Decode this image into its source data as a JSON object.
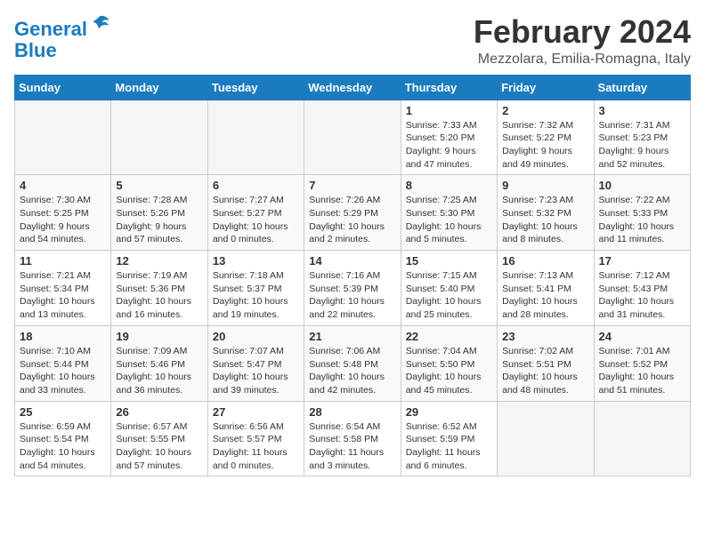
{
  "logo": {
    "line1": "General",
    "line2": "Blue"
  },
  "title": "February 2024",
  "subtitle": "Mezzolara, Emilia-Romagna, Italy",
  "days_header": [
    "Sunday",
    "Monday",
    "Tuesday",
    "Wednesday",
    "Thursday",
    "Friday",
    "Saturday"
  ],
  "weeks": [
    [
      {
        "day": "",
        "info": ""
      },
      {
        "day": "",
        "info": ""
      },
      {
        "day": "",
        "info": ""
      },
      {
        "day": "",
        "info": ""
      },
      {
        "day": "1",
        "info": "Sunrise: 7:33 AM\nSunset: 5:20 PM\nDaylight: 9 hours and 47 minutes."
      },
      {
        "day": "2",
        "info": "Sunrise: 7:32 AM\nSunset: 5:22 PM\nDaylight: 9 hours and 49 minutes."
      },
      {
        "day": "3",
        "info": "Sunrise: 7:31 AM\nSunset: 5:23 PM\nDaylight: 9 hours and 52 minutes."
      }
    ],
    [
      {
        "day": "4",
        "info": "Sunrise: 7:30 AM\nSunset: 5:25 PM\nDaylight: 9 hours and 54 minutes."
      },
      {
        "day": "5",
        "info": "Sunrise: 7:28 AM\nSunset: 5:26 PM\nDaylight: 9 hours and 57 minutes."
      },
      {
        "day": "6",
        "info": "Sunrise: 7:27 AM\nSunset: 5:27 PM\nDaylight: 10 hours and 0 minutes."
      },
      {
        "day": "7",
        "info": "Sunrise: 7:26 AM\nSunset: 5:29 PM\nDaylight: 10 hours and 2 minutes."
      },
      {
        "day": "8",
        "info": "Sunrise: 7:25 AM\nSunset: 5:30 PM\nDaylight: 10 hours and 5 minutes."
      },
      {
        "day": "9",
        "info": "Sunrise: 7:23 AM\nSunset: 5:32 PM\nDaylight: 10 hours and 8 minutes."
      },
      {
        "day": "10",
        "info": "Sunrise: 7:22 AM\nSunset: 5:33 PM\nDaylight: 10 hours and 11 minutes."
      }
    ],
    [
      {
        "day": "11",
        "info": "Sunrise: 7:21 AM\nSunset: 5:34 PM\nDaylight: 10 hours and 13 minutes."
      },
      {
        "day": "12",
        "info": "Sunrise: 7:19 AM\nSunset: 5:36 PM\nDaylight: 10 hours and 16 minutes."
      },
      {
        "day": "13",
        "info": "Sunrise: 7:18 AM\nSunset: 5:37 PM\nDaylight: 10 hours and 19 minutes."
      },
      {
        "day": "14",
        "info": "Sunrise: 7:16 AM\nSunset: 5:39 PM\nDaylight: 10 hours and 22 minutes."
      },
      {
        "day": "15",
        "info": "Sunrise: 7:15 AM\nSunset: 5:40 PM\nDaylight: 10 hours and 25 minutes."
      },
      {
        "day": "16",
        "info": "Sunrise: 7:13 AM\nSunset: 5:41 PM\nDaylight: 10 hours and 28 minutes."
      },
      {
        "day": "17",
        "info": "Sunrise: 7:12 AM\nSunset: 5:43 PM\nDaylight: 10 hours and 31 minutes."
      }
    ],
    [
      {
        "day": "18",
        "info": "Sunrise: 7:10 AM\nSunset: 5:44 PM\nDaylight: 10 hours and 33 minutes."
      },
      {
        "day": "19",
        "info": "Sunrise: 7:09 AM\nSunset: 5:46 PM\nDaylight: 10 hours and 36 minutes."
      },
      {
        "day": "20",
        "info": "Sunrise: 7:07 AM\nSunset: 5:47 PM\nDaylight: 10 hours and 39 minutes."
      },
      {
        "day": "21",
        "info": "Sunrise: 7:06 AM\nSunset: 5:48 PM\nDaylight: 10 hours and 42 minutes."
      },
      {
        "day": "22",
        "info": "Sunrise: 7:04 AM\nSunset: 5:50 PM\nDaylight: 10 hours and 45 minutes."
      },
      {
        "day": "23",
        "info": "Sunrise: 7:02 AM\nSunset: 5:51 PM\nDaylight: 10 hours and 48 minutes."
      },
      {
        "day": "24",
        "info": "Sunrise: 7:01 AM\nSunset: 5:52 PM\nDaylight: 10 hours and 51 minutes."
      }
    ],
    [
      {
        "day": "25",
        "info": "Sunrise: 6:59 AM\nSunset: 5:54 PM\nDaylight: 10 hours and 54 minutes."
      },
      {
        "day": "26",
        "info": "Sunrise: 6:57 AM\nSunset: 5:55 PM\nDaylight: 10 hours and 57 minutes."
      },
      {
        "day": "27",
        "info": "Sunrise: 6:56 AM\nSunset: 5:57 PM\nDaylight: 11 hours and 0 minutes."
      },
      {
        "day": "28",
        "info": "Sunrise: 6:54 AM\nSunset: 5:58 PM\nDaylight: 11 hours and 3 minutes."
      },
      {
        "day": "29",
        "info": "Sunrise: 6:52 AM\nSunset: 5:59 PM\nDaylight: 11 hours and 6 minutes."
      },
      {
        "day": "",
        "info": ""
      },
      {
        "day": "",
        "info": ""
      }
    ]
  ]
}
